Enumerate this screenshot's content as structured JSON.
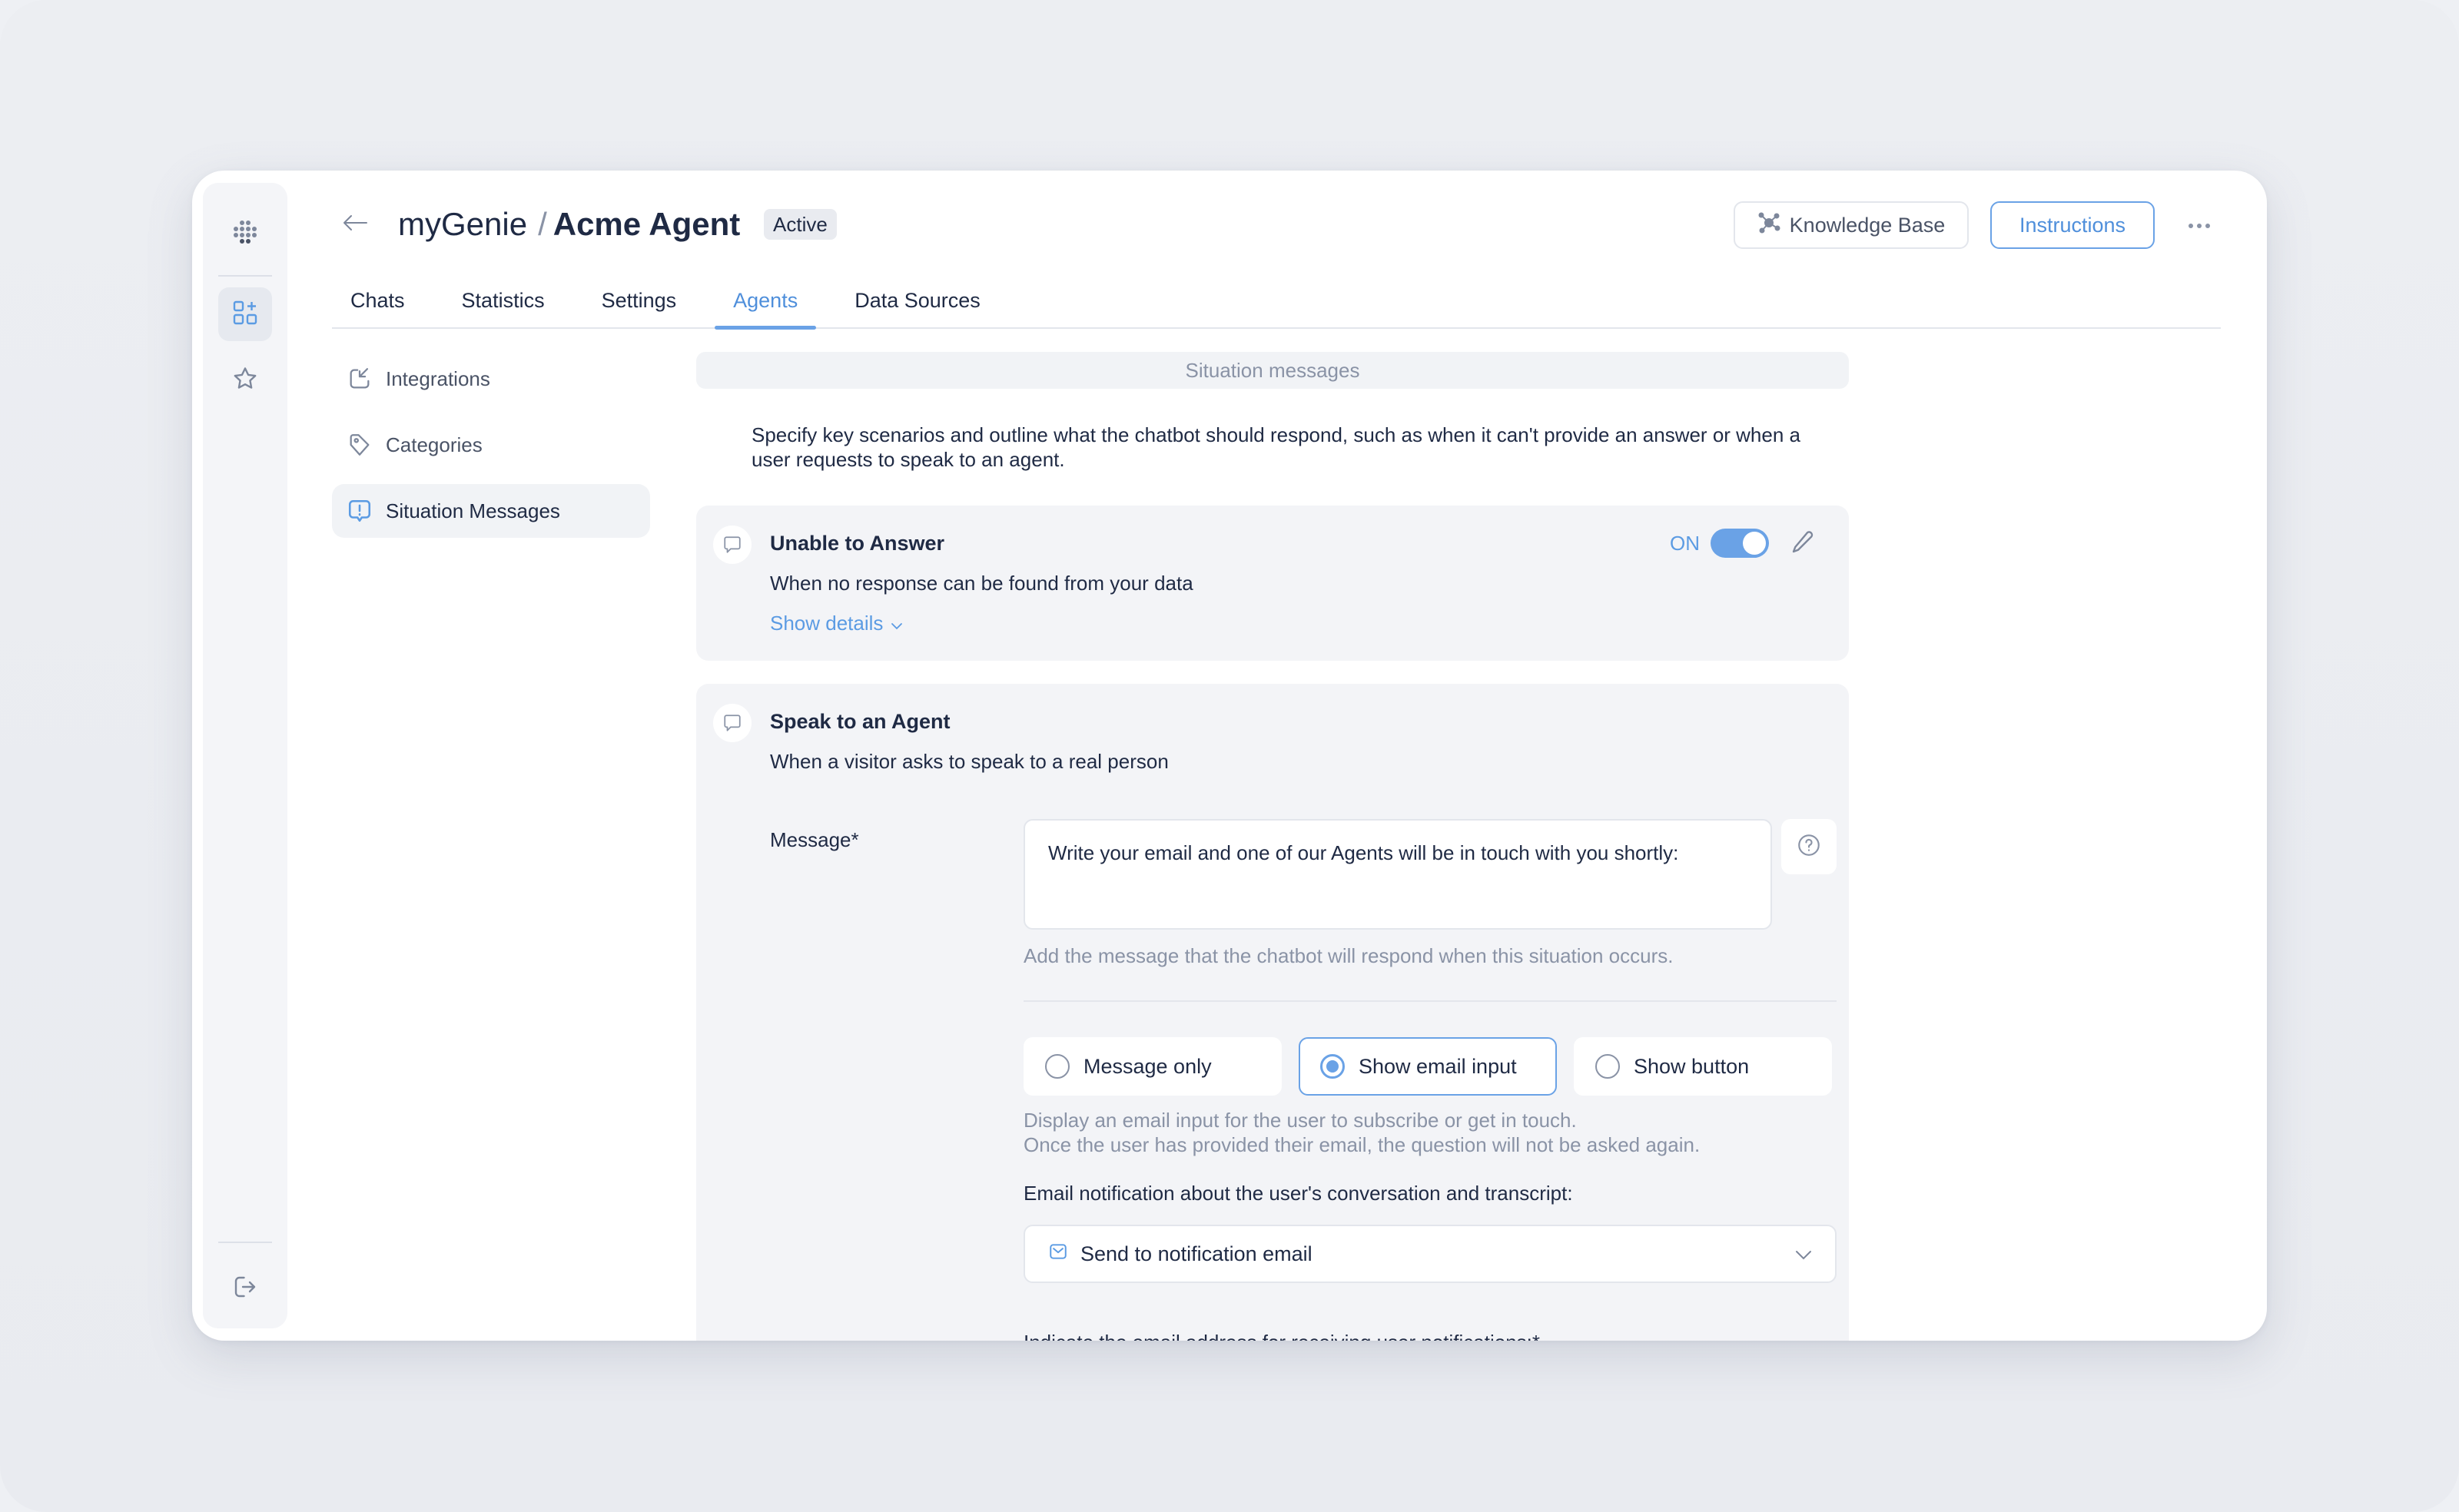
{
  "app": {
    "breadcrumb_root": "myGenie",
    "breadcrumb_separator": "/",
    "agent_name": "Acme Agent",
    "status_badge": "Active"
  },
  "header_actions": {
    "knowledge_base": "Knowledge Base",
    "instructions": "Instructions"
  },
  "tabs": [
    {
      "label": "Chats",
      "active": false
    },
    {
      "label": "Statistics",
      "active": false
    },
    {
      "label": "Settings",
      "active": false
    },
    {
      "label": "Agents",
      "active": true
    },
    {
      "label": "Data Sources",
      "active": false
    }
  ],
  "left_nav": [
    {
      "label": "Integrations",
      "icon": "integrations-icon",
      "active": false
    },
    {
      "label": "Categories",
      "icon": "tag-icon",
      "active": false
    },
    {
      "label": "Situation Messages",
      "icon": "alert-message-icon",
      "active": true
    }
  ],
  "main": {
    "section_title": "Situation messages",
    "intro": "Specify key scenarios and outline what the chatbot should respond, such as when it can't provide an answer or when a user requests to speak to an agent.",
    "situations": [
      {
        "title": "Unable to Answer",
        "description": "When no response can be found from your data",
        "toggle_label": "ON",
        "toggle_on": true,
        "show_details": "Show details"
      },
      {
        "title": "Speak to an Agent",
        "description": "When a visitor asks to speak to a real person",
        "message_label": "Message*",
        "message_value": "Write your email and one of our Agents will be in touch with you shortly:",
        "message_hint": "Add the message that the chatbot will respond when this situation occurs.",
        "response_options": [
          {
            "label": "Message only",
            "selected": false
          },
          {
            "label": "Show email input",
            "selected": true
          },
          {
            "label": "Show button",
            "selected": false
          }
        ],
        "option_hint_line1": "Display an email input for the user to subscribe or get in touch.",
        "option_hint_line2": "Once the user has provided their email, the question will not be asked again.",
        "email_notification_label": "Email notification about the user's conversation and transcript:",
        "email_notification_value": "Send to notification email",
        "email_address_label": "Indicate the email address for receiving user notifications:*"
      }
    ]
  },
  "colors": {
    "accent": "#6aa2e6",
    "accent_text": "#4f8fdb",
    "text_primary": "#1f2a44",
    "text_muted": "#8a93a6",
    "card_bg": "#f3f4f7"
  }
}
